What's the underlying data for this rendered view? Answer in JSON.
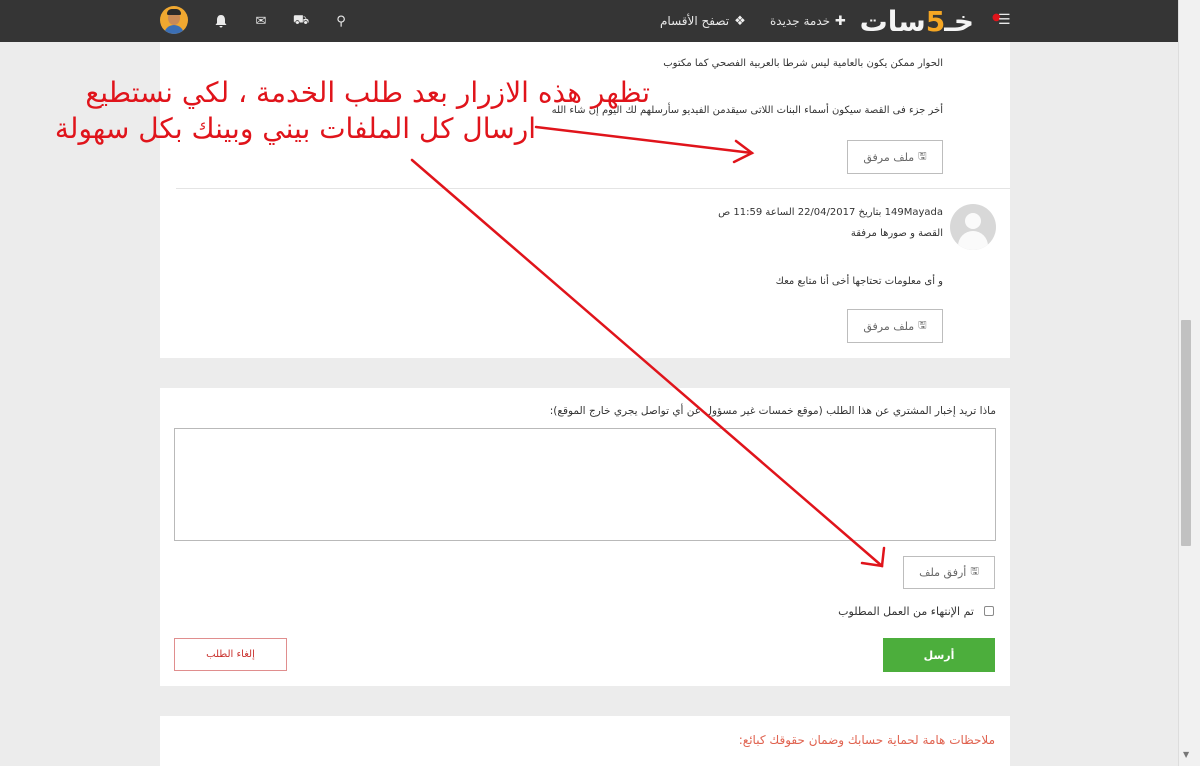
{
  "navbar": {
    "logo_prefix": "خـ",
    "logo_five": "5",
    "logo_suffix": "سات",
    "new_service": "خدمة جديدة",
    "browse_categories": "تصفح الأقسام"
  },
  "thread": {
    "msg1_line1": "الحوار ممكن يكون بالعامية ليس شرطا بالعربية الفصحي كما مكتوب",
    "msg1_line2": "أخر جزء فى القصة سيكون أسماء البنات اللاتى سيقدمن الفيديو سأرسلهم لك اليوم إن شاء الله",
    "attachment_label": "ملف مرفق",
    "msg2_meta": "149Mayada بتاريخ 22/04/2017 الساعة 11:59 ص",
    "msg2_line1": "القصة و صورها مرفقة",
    "msg2_line2": "و أى معلومات تحتاجها أخى أنا متابع معك"
  },
  "reply_form": {
    "prompt": "ماذا تريد إخبار المشتري عن هذا الطلب (موقع خمسات غير مسؤول عن أي تواصل يجري خارج الموقع):",
    "attach_button": "أرفق ملف",
    "done_checkbox_label": "تم الإنتهاء من العمل المطلوب",
    "send_button": "أرسل",
    "cancel_button": "إلغاء الطلب"
  },
  "notes": {
    "title": "ملاحظات هامة لحماية حسابك وضمان حقوقك كبائع:"
  },
  "annotation": {
    "line1": "تظهر هذه الازرار بعد طلب الخدمة ، لكي نستطيع",
    "line2": "ارسال كل الملفات بيني وبينك بكل سهولة",
    "color": "#e0141b"
  },
  "icons": {
    "menu": "☰",
    "plus": "✚",
    "categories": "❖",
    "search": "⚲",
    "cart": "⛟",
    "mail": "✉",
    "bell": "🔔",
    "file": "🖫"
  },
  "colors": {
    "navbar": "#353535",
    "send": "#4cae3c",
    "cancel_text": "#c9302c",
    "notes_title": "#e0624f",
    "logo_accent": "#f5a623"
  }
}
